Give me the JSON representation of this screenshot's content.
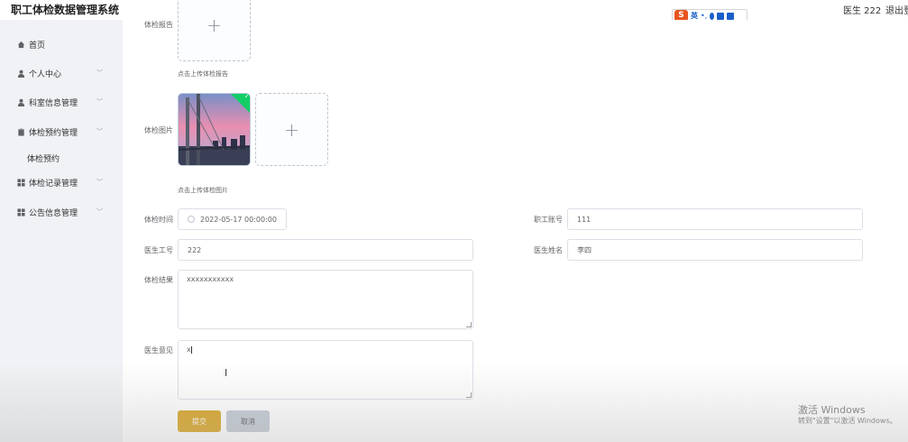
{
  "header": {
    "title": "职工体检数据管理系统",
    "user_label": "医生 222",
    "logout_label": "退出登"
  },
  "ime": {
    "logo_glyph": "S",
    "lang_label": "英"
  },
  "sidebar": {
    "items": [
      {
        "label": "首页",
        "icon": "home-icon"
      },
      {
        "label": "个人中心",
        "icon": "user-icon"
      },
      {
        "label": "科室信息管理",
        "icon": "user-icon"
      },
      {
        "label": "体检预约管理",
        "icon": "clipboard-icon"
      },
      {
        "label": "体检记录管理",
        "icon": "grid-icon"
      },
      {
        "label": "公告信息管理",
        "icon": "grid-icon"
      }
    ],
    "subitem": "体检预约"
  },
  "form": {
    "report_label": "体检报告",
    "report_tip": "点击上传体检报告",
    "image_label": "体检图片",
    "image_tip": "点击上传体检图片",
    "time_label": "体检时间",
    "time_value": "2022-05-17 00:00:00",
    "account_label": "职工账号",
    "account_value": "111",
    "doctor_id_label": "医生工号",
    "doctor_id_value": "222",
    "doctor_name_label": "医生姓名",
    "doctor_name_value": "李四",
    "result_label": "体检结果",
    "result_value": "xxxxxxxxxxx",
    "opinion_label": "医生意见",
    "opinion_value": "x",
    "submit_label": "提交",
    "cancel_label": "取消",
    "upload_plus": "+"
  },
  "watermark": {
    "title": "激活 Windows",
    "subtitle": "转到\"设置\"以激活 Windows。"
  },
  "colors": {
    "submit": "#d9a320",
    "cancel": "#c2c9d3",
    "success_check": "#13ce66"
  }
}
